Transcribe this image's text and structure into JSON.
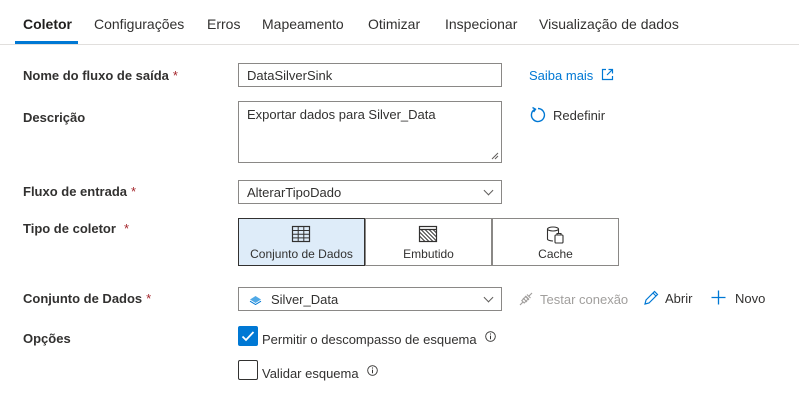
{
  "tabs": [
    {
      "label": "Coletor",
      "active": true
    },
    {
      "label": "Configurações"
    },
    {
      "label": "Erros"
    },
    {
      "label": "Mapeamento"
    },
    {
      "label": "Otimizar"
    },
    {
      "label": "Inspecionar"
    },
    {
      "label": "Visualização de dados"
    }
  ],
  "form": {
    "output_stream": {
      "label": "Nome do fluxo de saída",
      "required": "*",
      "value": "DataSilverSink",
      "learn_more": "Saiba mais"
    },
    "description": {
      "label": "Descrição",
      "value": "Exportar dados para Silver_Data",
      "reset": "Redefinir"
    },
    "input_stream": {
      "label": "Fluxo de entrada",
      "required": "*",
      "value": "AlterarTipoDado"
    },
    "sink_type": {
      "label": "Tipo de coletor",
      "required": "*",
      "options": [
        {
          "label": "Conjunto de Dados",
          "icon": "table-icon",
          "selected": true
        },
        {
          "label": "Embutido",
          "icon": "inline-hatch-icon"
        },
        {
          "label": "Cache",
          "icon": "cache-icon"
        }
      ]
    },
    "dataset": {
      "label": "Conjunto de Dados",
      "required": "*",
      "value": "Silver_Data",
      "test_connection": "Testar conexão",
      "open": "Abrir",
      "new": "Novo"
    },
    "options": {
      "label": "Opções",
      "allow_schema_drift": {
        "label": "Permitir o descompasso de esquema",
        "checked": true
      },
      "validate_schema": {
        "label": "Validar esquema",
        "checked": false
      }
    }
  },
  "colors": {
    "accent": "#0078d4",
    "required": "#a4262c",
    "selected_bg": "#deecf9"
  }
}
